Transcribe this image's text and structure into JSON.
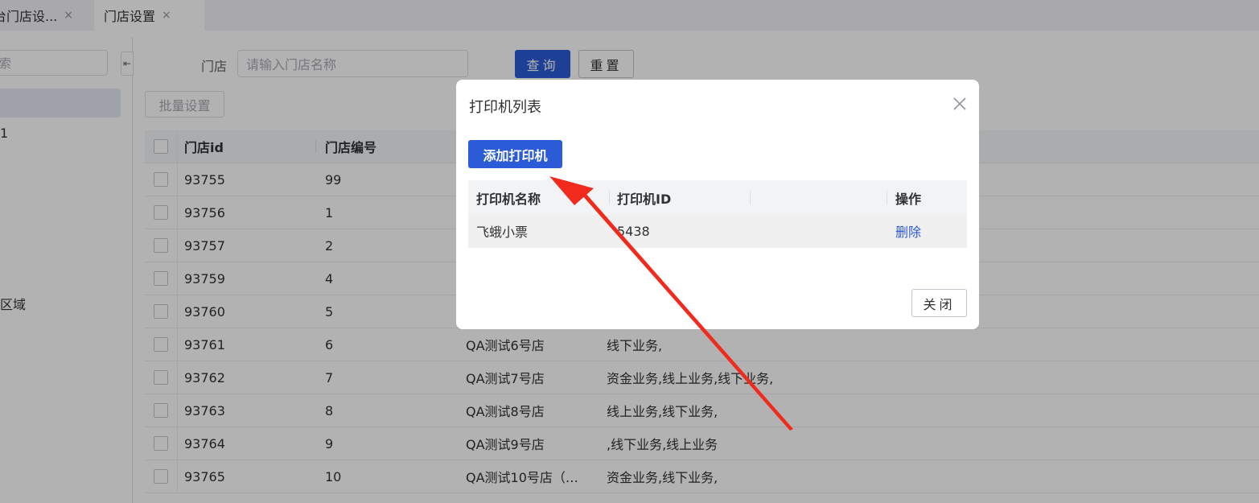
{
  "tabs": [
    {
      "label": "台门店设...",
      "close": "×"
    },
    {
      "label": "门店设置",
      "close": "×"
    }
  ],
  "left": {
    "search_placeholder": "索",
    "collapse_icon": "⇤",
    "tree_items": [
      "1",
      "区域"
    ]
  },
  "filter": {
    "label": "门店",
    "placeholder": "请输入门店名称",
    "query_label": "查询",
    "reset_label": "重置"
  },
  "toolbar": {
    "batch_label": "批量设置"
  },
  "table": {
    "headers": [
      "门店id",
      "门店编号"
    ],
    "rows": [
      {
        "id": "93755",
        "no": "99",
        "name": "",
        "biz": ""
      },
      {
        "id": "93756",
        "no": "1",
        "name": "",
        "biz": ""
      },
      {
        "id": "93757",
        "no": "2",
        "name": "",
        "biz": ""
      },
      {
        "id": "93759",
        "no": "4",
        "name": "",
        "biz": ""
      },
      {
        "id": "93760",
        "no": "5",
        "name": "",
        "biz": ""
      },
      {
        "id": "93761",
        "no": "6",
        "name": "QA测试6号店",
        "biz": "线下业务,"
      },
      {
        "id": "93762",
        "no": "7",
        "name": "QA测试7号店",
        "biz": "资金业务,线上业务,线下业务,"
      },
      {
        "id": "93763",
        "no": "8",
        "name": "QA测试8号店",
        "biz": "线上业务,线下业务,"
      },
      {
        "id": "93764",
        "no": "9",
        "name": "QA测试9号店",
        "biz": ",线下业务,线上业务"
      },
      {
        "id": "93765",
        "no": "10",
        "name": "QA测试10号店（…",
        "biz": "资金业务,线下业务,"
      }
    ]
  },
  "dialog": {
    "title": "打印机列表",
    "add_label": "添加打印机",
    "headers": [
      "打印机名称",
      "打印机ID",
      "操作"
    ],
    "rows": [
      {
        "name": "飞蛾小票",
        "id": "5438",
        "op": "删除"
      }
    ],
    "close_label": "关闭"
  },
  "colors": {
    "primary": "#2b5bd7",
    "arrow": "#f02b1d"
  }
}
